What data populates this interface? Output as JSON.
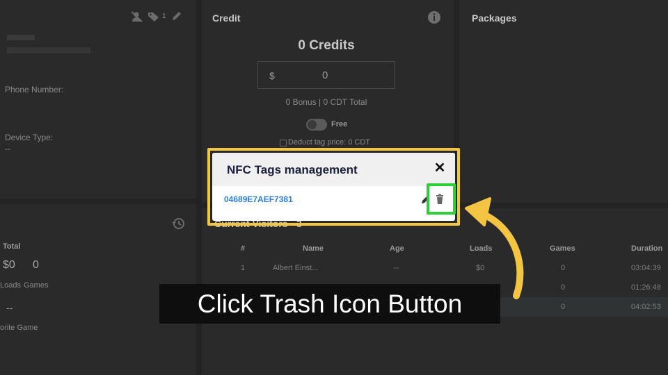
{
  "profile": {
    "phone_label": "Phone Number:",
    "device_label": "Device Type:",
    "device_value": "--",
    "tag_count": "1"
  },
  "credit": {
    "title": "Credit",
    "credits_value": "0 Credits",
    "currency_symbol": "$",
    "amount_value": "0",
    "bonus_summary": "0 Bonus | 0 CDT Total",
    "free_label": "Free",
    "deduct_label": "Deduct tag price: 0 CDT"
  },
  "packages": {
    "title": "Packages"
  },
  "stats": {
    "total_label": "Total",
    "loads_value": "$0",
    "games_value": "0",
    "loads_label": "Loads",
    "games_label": "Games",
    "dash_value": "--",
    "favorite_label": "orite Game"
  },
  "visitors": {
    "title": "Current Visitors - 3",
    "columns": [
      "#",
      "Name",
      "Age",
      "Loads",
      "Games",
      "Duration"
    ],
    "rows": [
      [
        "1",
        "Albert Einst...",
        "--",
        "$0",
        "0",
        "03:04:39"
      ],
      [
        "",
        "",
        "",
        "",
        "0",
        "01:26:48"
      ],
      [
        "",
        "",
        "",
        "",
        "0",
        "04:02:53"
      ]
    ]
  },
  "modal": {
    "title": "NFC Tags management",
    "close_symbol": "✕",
    "tag_id": "04689E7AEF7381"
  },
  "caption": {
    "text": "Click Trash Icon Button"
  },
  "colors": {
    "highlight_outline": "#f4c443",
    "trash_highlight": "#2fcf37",
    "arrow": "#f4c443",
    "tag_link": "#2d7fd8"
  }
}
